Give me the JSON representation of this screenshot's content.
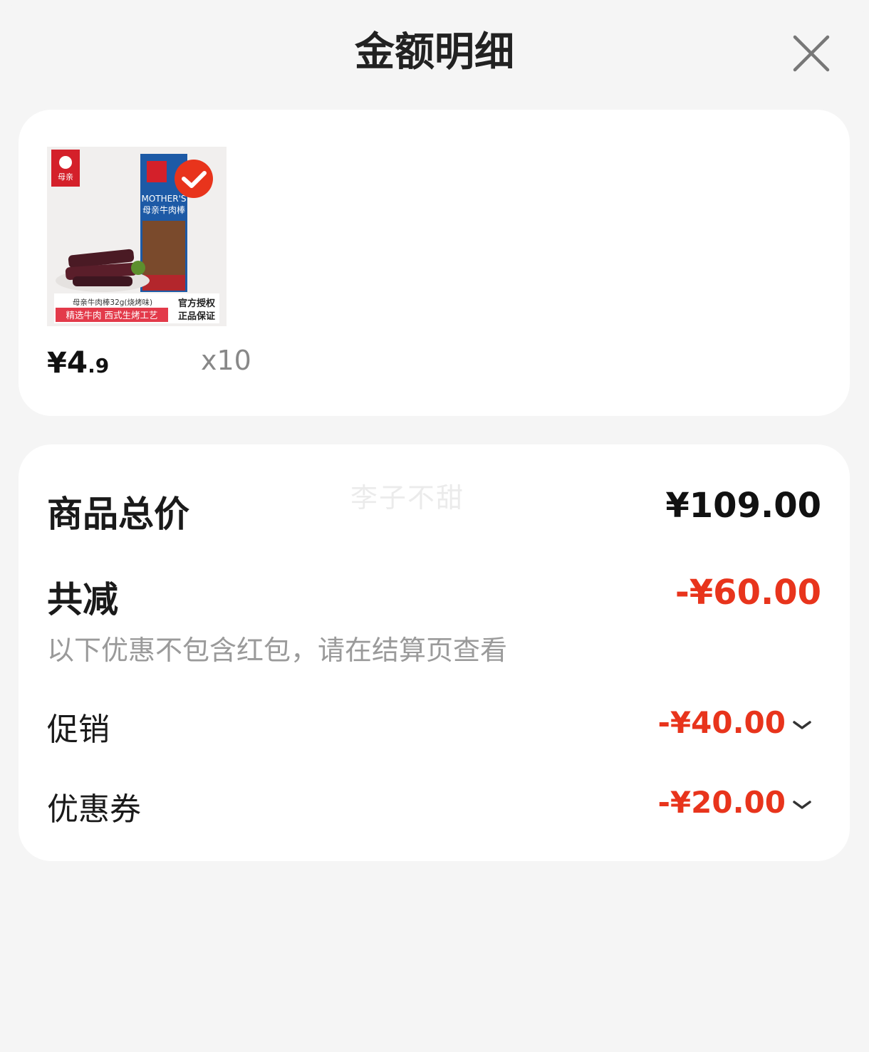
{
  "header": {
    "title": "金额明细",
    "close_icon": "close-icon"
  },
  "product": {
    "image_alt": "母亲牛肉棒",
    "image_brand": "母亲",
    "image_brand_en": "MOTHER'S",
    "image_name": "母亲牛肉棒",
    "image_caption": "母亲牛肉棒32g(烧烤味)",
    "image_slogan": "精选牛肉 西式生烤工艺",
    "image_badge_line1": "官方授权",
    "image_badge_line2": "正品保证",
    "selected": true,
    "price_currency": "¥",
    "price_int": "4",
    "price_dec": ".9",
    "quantity": "x10"
  },
  "summary": {
    "watermark": "李子不甜",
    "subtotal_label": "商品总价",
    "subtotal_value": "¥109.00",
    "discount_label": "共减",
    "discount_value": "-¥60.00",
    "note": "以下优惠不包含红包，请在结算页查看",
    "items": [
      {
        "label": "促销",
        "value": "-¥40.00",
        "icon": "chevron-down-icon"
      },
      {
        "label": "优惠券",
        "value": "-¥20.00",
        "icon": "chevron-down-icon"
      }
    ]
  },
  "colors": {
    "accent": "#e8341c",
    "background": "#f5f5f5",
    "card": "#ffffff"
  }
}
